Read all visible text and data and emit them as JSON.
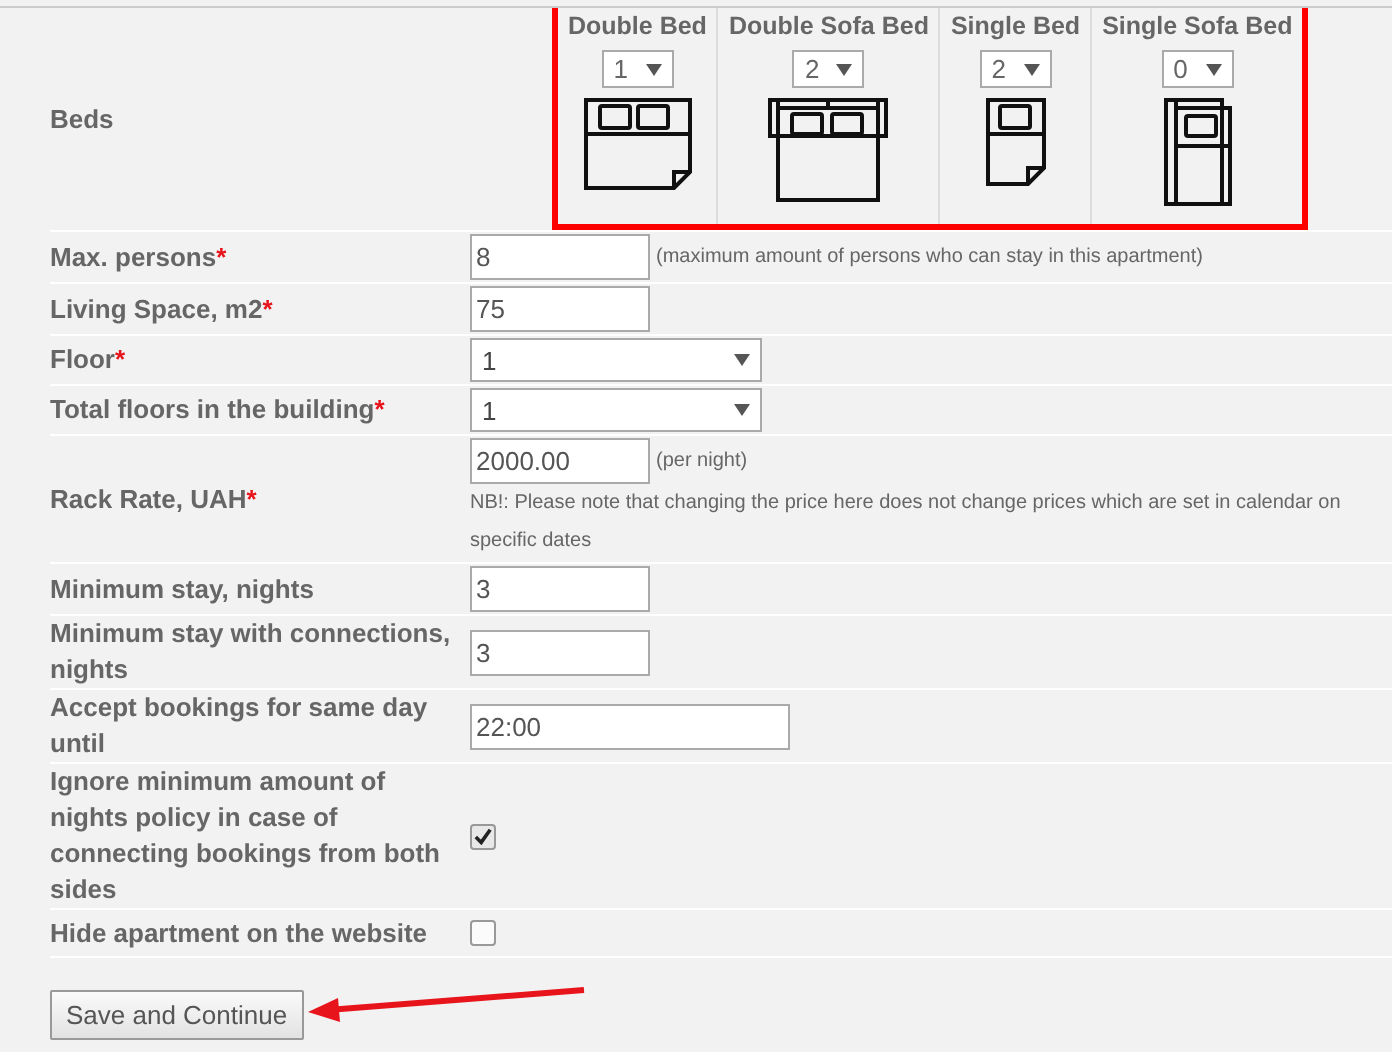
{
  "beds": {
    "label": "Beds",
    "highlighted": true,
    "types": [
      {
        "name": "Double Bed",
        "count": "1",
        "kind": "double"
      },
      {
        "name": "Double Sofa Bed",
        "count": "2",
        "kind": "double_sofa"
      },
      {
        "name": "Single Bed",
        "count": "2",
        "kind": "single"
      },
      {
        "name": "Single Sofa Bed",
        "count": "0",
        "kind": "single_sofa"
      }
    ]
  },
  "fields": [
    {
      "kind": "text",
      "label": "Max. persons",
      "mark": "*",
      "value": "8",
      "hint": "(maximum amount of persons who can stay in this apartment)"
    },
    {
      "kind": "text",
      "label": "Living Space, m2",
      "mark": "*",
      "value": "75"
    },
    {
      "kind": "select",
      "label": "Floor",
      "mark": "*",
      "value": "1"
    },
    {
      "kind": "select",
      "label": "Total floors in the building",
      "mark": "*",
      "value": "1"
    },
    {
      "kind": "price",
      "label": "Rack Rate, UAH",
      "mark": "*",
      "value": "2000.00",
      "hint": "(per night)",
      "note": "NB!: Please note that changing the price here does not change prices which are set in calendar on specific dates"
    },
    {
      "kind": "text",
      "label": "Minimum stay, nights",
      "value": "3"
    },
    {
      "kind": "text",
      "label": "Minimum stay with connections, nights",
      "value": "3"
    },
    {
      "kind": "wide",
      "label": "Accept bookings for same day until",
      "value": "22:00"
    },
    {
      "kind": "checkbox",
      "label": "Ignore minimum amount of nights policy in case of connecting bookings from both sides",
      "checked": true
    },
    {
      "kind": "checkbox",
      "label": "Hide apartment on the website",
      "checked": false
    }
  ],
  "save_button": {
    "label": "Save and Continue",
    "arrow": true
  }
}
